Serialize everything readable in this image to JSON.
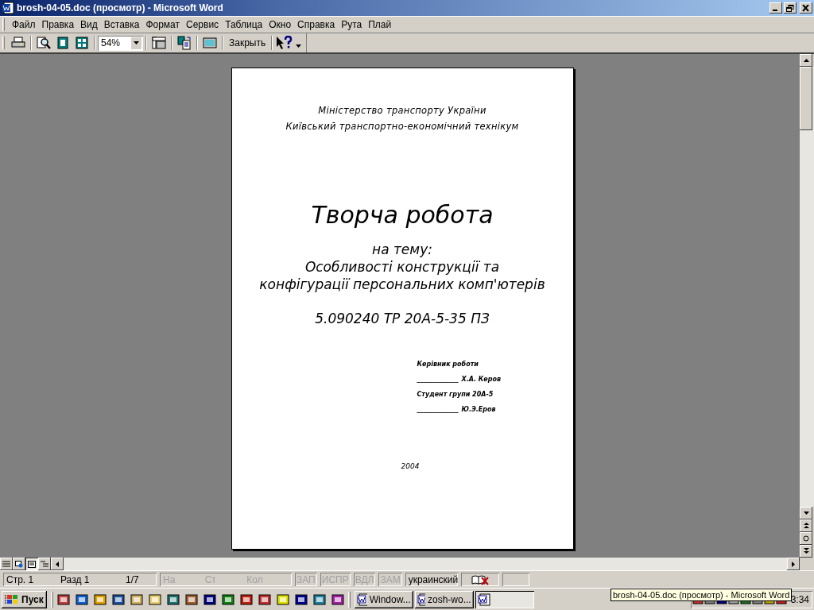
{
  "window": {
    "title": "brosh-04-05.doc (просмотр) - Microsoft Word"
  },
  "menu": [
    {
      "label": "Файл"
    },
    {
      "label": "Правка"
    },
    {
      "label": "Вид"
    },
    {
      "label": "Вставка"
    },
    {
      "label": "Формат"
    },
    {
      "label": "Сервис"
    },
    {
      "label": "Таблица"
    },
    {
      "label": "Окно"
    },
    {
      "label": "Справка"
    },
    {
      "label": "Рута"
    },
    {
      "label": "Плай"
    }
  ],
  "toolbar": {
    "zoom": "54%",
    "close_button": {
      "label": "Закрыть"
    }
  },
  "document": {
    "header": [
      "Міністерство транспорту України",
      "Київський транспортно-економічний технікум"
    ],
    "title": "Творча робота",
    "subtitle": [
      "на тему:",
      "Особливості конструкції та",
      "конфігурації персональних комп'ютерів"
    ],
    "code": "5.090240 ТР 20А-5-35 ПЗ",
    "signatures": [
      {
        "role": "Керівник роботи",
        "line": "_____________",
        "name": "Х.А. Керов"
      },
      {
        "role": "Студент групи 20А-5",
        "line": "_____________",
        "name": "Ю.Э.Еров"
      }
    ],
    "year": "2004"
  },
  "status_bar": {
    "page_info": [
      "Стр. 1",
      "Разд 1",
      "1/7"
    ],
    "cursor_info": [
      {
        "text": "На",
        "disabled": true
      },
      {
        "text": "Ст",
        "disabled": true
      },
      {
        "text": "Кол",
        "disabled": true
      }
    ],
    "modes": [
      {
        "text": "ЗАП",
        "disabled": true
      },
      {
        "text": "ИСПР",
        "disabled": true
      },
      {
        "text": "ВДЛ",
        "disabled": true
      },
      {
        "text": "ЗАМ",
        "disabled": true
      }
    ],
    "language": "украинский"
  },
  "taskbar": {
    "start": "Пуск",
    "tasks": [
      {
        "label": "Window...",
        "selected": false
      },
      {
        "label": "zosh-wo...",
        "selected": false
      },
      {
        "selected": true
      }
    ],
    "clock": "3:34"
  },
  "tooltip": {
    "text": "brosh-04-05.doc (просмотр) - Microsoft Word"
  }
}
